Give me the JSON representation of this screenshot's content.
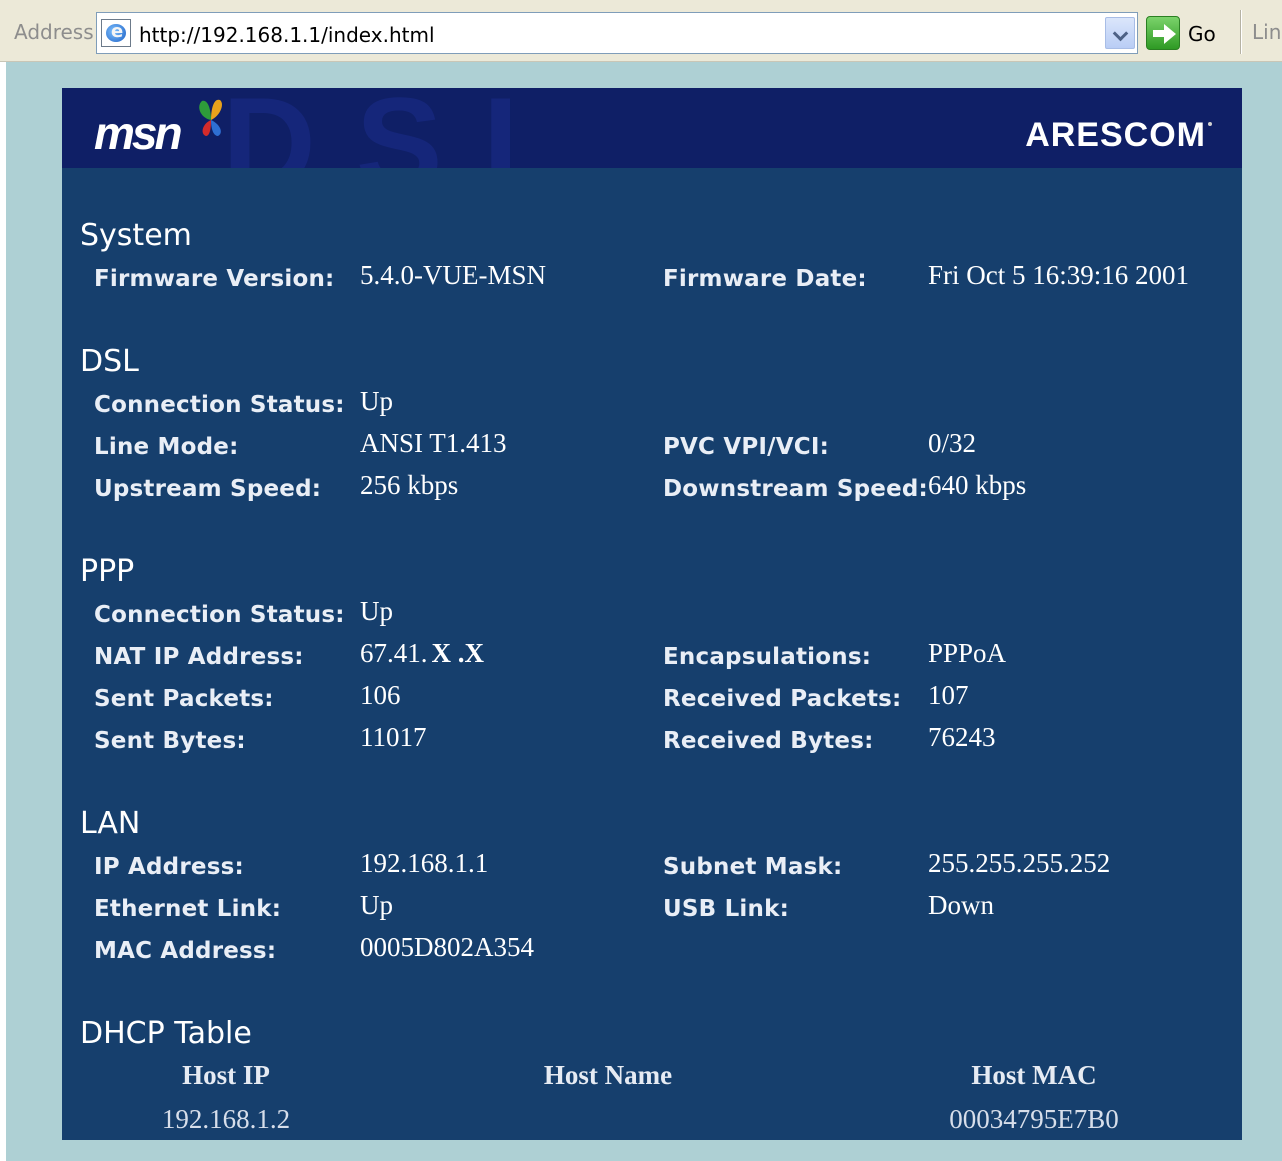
{
  "browser": {
    "address_label": "Address",
    "url": "http://192.168.1.1/index.html",
    "go_label": "Go",
    "links_label": "Link"
  },
  "banner": {
    "left_logo": "msn",
    "right_logo": "ARESCOM",
    "watermark": "DSL"
  },
  "system": {
    "title": "System",
    "firmware_version_label": "Firmware Version:",
    "firmware_version": "5.4.0-VUE-MSN",
    "firmware_date_label": "Firmware Date:",
    "firmware_date": "Fri Oct 5 16:39:16 2001"
  },
  "dsl": {
    "title": "DSL",
    "connection_status_label": "Connection Status:",
    "connection_status": "Up",
    "line_mode_label": "Line Mode:",
    "line_mode": "ANSI T1.413",
    "pvc_label": "PVC VPI/VCI:",
    "pvc": "0/32",
    "upstream_label": "Upstream Speed:",
    "upstream": "256 kbps",
    "downstream_label": "Downstream Speed:",
    "downstream": "640 kbps"
  },
  "ppp": {
    "title": "PPP",
    "connection_status_label": "Connection Status:",
    "connection_status": "Up",
    "nat_ip_label": "NAT IP Address:",
    "nat_ip": "67.41.",
    "nat_ip_masked": "X .X",
    "encapsulations_label": "Encapsulations:",
    "encapsulations": "PPPoA",
    "sent_packets_label": "Sent Packets:",
    "sent_packets": "106",
    "received_packets_label": "Received Packets:",
    "received_packets": "107",
    "sent_bytes_label": "Sent Bytes:",
    "sent_bytes": "11017",
    "received_bytes_label": "Received Bytes:",
    "received_bytes": "76243"
  },
  "lan": {
    "title": "LAN",
    "ip_label": "IP Address:",
    "ip": "192.168.1.1",
    "subnet_label": "Subnet Mask:",
    "subnet": "255.255.255.252",
    "ethernet_label": "Ethernet Link:",
    "ethernet": "Up",
    "usb_label": "USB Link:",
    "usb": "Down",
    "mac_label": "MAC Address:",
    "mac": "0005D802A354"
  },
  "dhcp": {
    "title": "DHCP Table",
    "columns": [
      "Host IP",
      "Host Name",
      "Host MAC"
    ],
    "rows": [
      {
        "host_ip": "192.168.1.2",
        "host_name": "",
        "host_mac": "00034795E7B0"
      }
    ]
  },
  "colors": {
    "panel": "#163f6d",
    "banner": "#0f1f66",
    "page_background": "#aed0d4"
  }
}
